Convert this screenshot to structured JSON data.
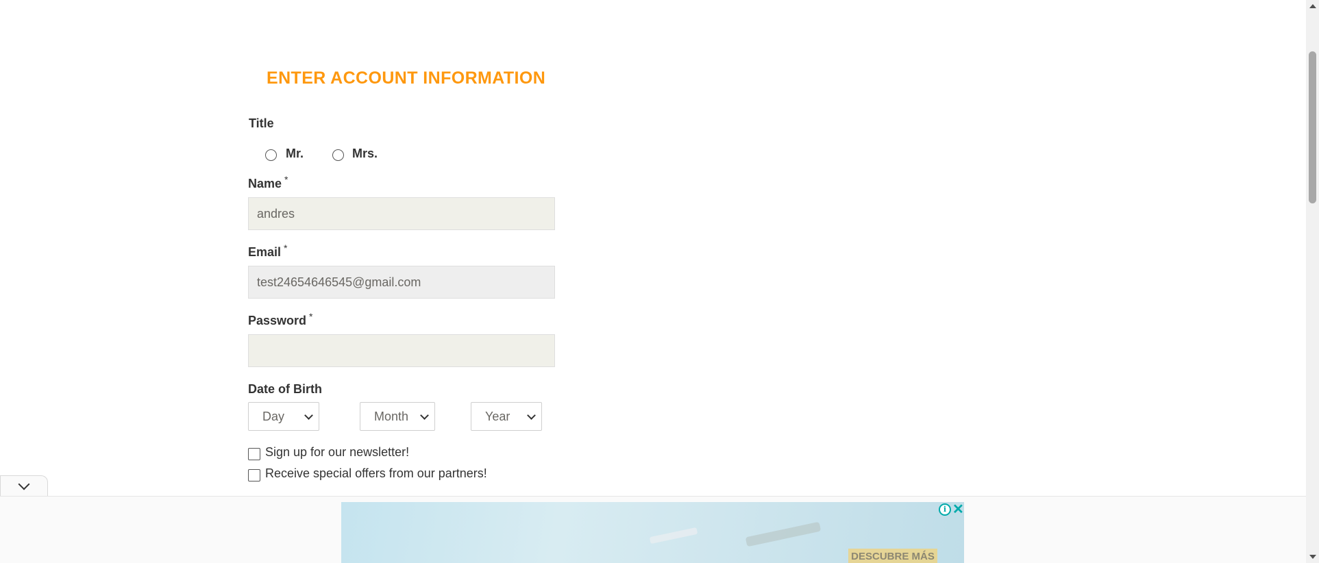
{
  "form": {
    "heading": "ENTER ACCOUNT INFORMATION",
    "title_label": "Title",
    "title_options": [
      "Mr.",
      "Mrs."
    ],
    "name_label": "Name",
    "name_value": "andres",
    "email_label": "Email",
    "email_value": "test24654646545@gmail.com",
    "password_label": "Password",
    "password_value": "",
    "required_mark": "*",
    "dob_label": "Date of Birth",
    "dob_day": "Day",
    "dob_month": "Month",
    "dob_year": "Year",
    "newsletter_label": "Sign up for our newsletter!",
    "offers_label": "Receive special offers from our partners!"
  },
  "ad": {
    "cta": "DESCUBRE MÁS",
    "info_icon": "info-icon",
    "close_icon": "close-icon"
  },
  "colors": {
    "accent": "#FE980F",
    "field_bg": "#F0F0E9"
  }
}
